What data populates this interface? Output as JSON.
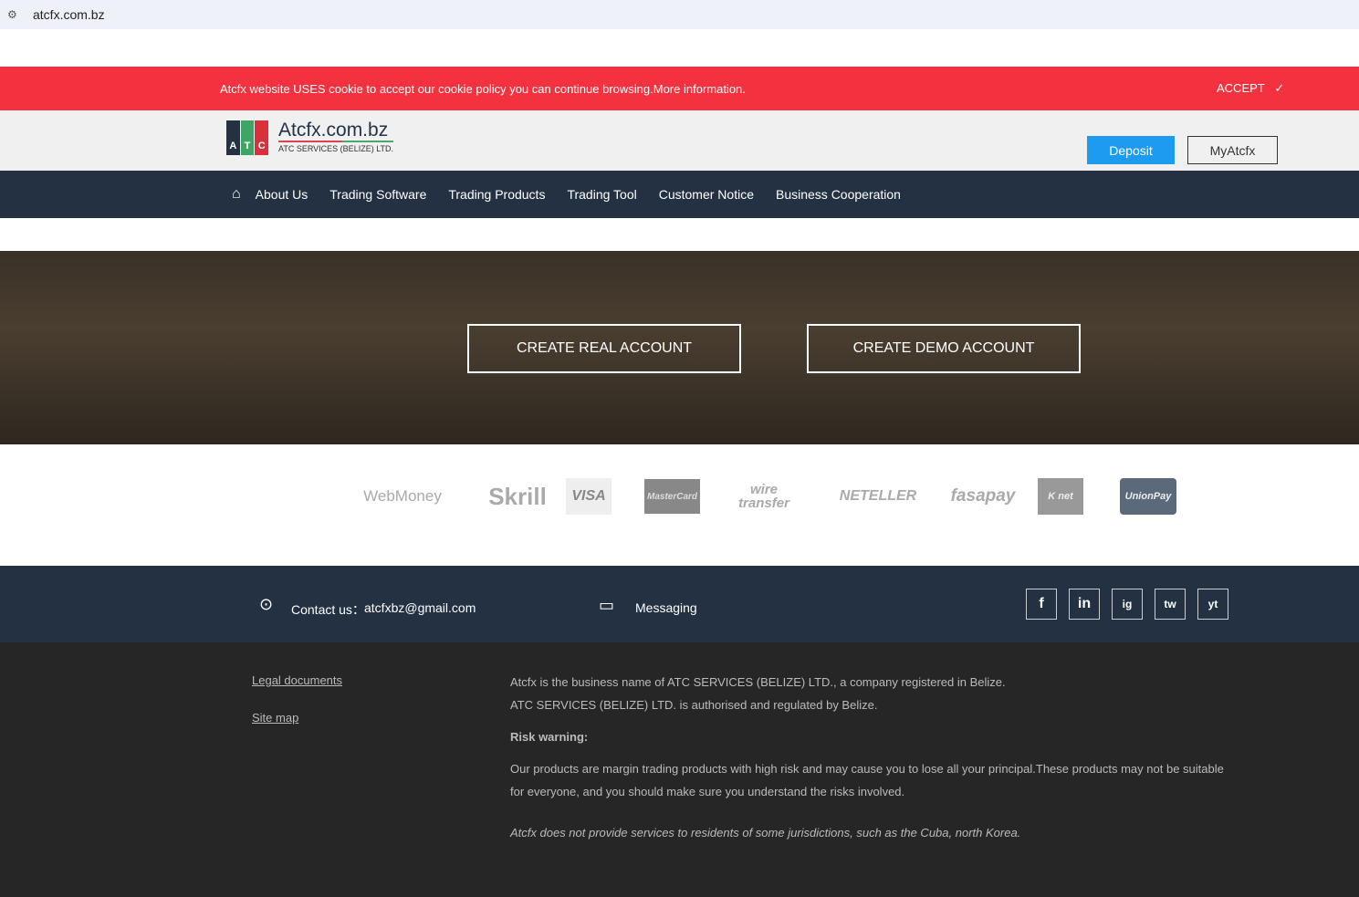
{
  "browser": {
    "url": "atcfx.com.bz"
  },
  "cookie": {
    "message": "Atcfx website USES cookie to accept our cookie policy you can continue browsing.More information.",
    "accept": "ACCEPT"
  },
  "header": {
    "logo_title": "Atcfx.com.bz",
    "logo_sub": "ATC SERVICES (BELIZE) LTD.",
    "logo_letters": [
      "A",
      "T",
      "C"
    ],
    "deposit": "Deposit",
    "myatcfx": "MyAtcfx"
  },
  "nav": [
    "About Us",
    "Trading Software",
    "Trading Products",
    "Trading Tool",
    "Customer Notice",
    "Business Cooperation"
  ],
  "hero": {
    "real": "CREATE REAL ACCOUNT",
    "demo": "CREATE DEMO ACCOUNT"
  },
  "payments": [
    "WebMoney",
    "Skrill",
    "VISA",
    "MasterCard",
    "wire transfer",
    "NETELLER",
    "fasapay",
    "K net",
    "UnionPay"
  ],
  "contact": {
    "label": "Contact us：",
    "email": "atcfxbz@gmail.com",
    "messaging": "Messaging",
    "social": [
      "f",
      "in",
      "ig",
      "tw",
      "yt"
    ]
  },
  "footer": {
    "legal": "Legal documents",
    "sitemap": "Site map",
    "line1": "Atcfx is the business name of ATC SERVICES (BELIZE) LTD., a company registered in Belize.",
    "line2": "ATC SERVICES (BELIZE) LTD. is authorised and regulated by Belize.",
    "risk_title": "Risk warning:",
    "risk": "Our products are margin trading products with high risk and may cause you to lose all your principal.These products may not be suitable for everyone, and you should make sure you understand the risks involved.",
    "jurisdiction": "Atcfx does not provide services to residents of some jurisdictions, such as the Cuba, north Korea."
  }
}
